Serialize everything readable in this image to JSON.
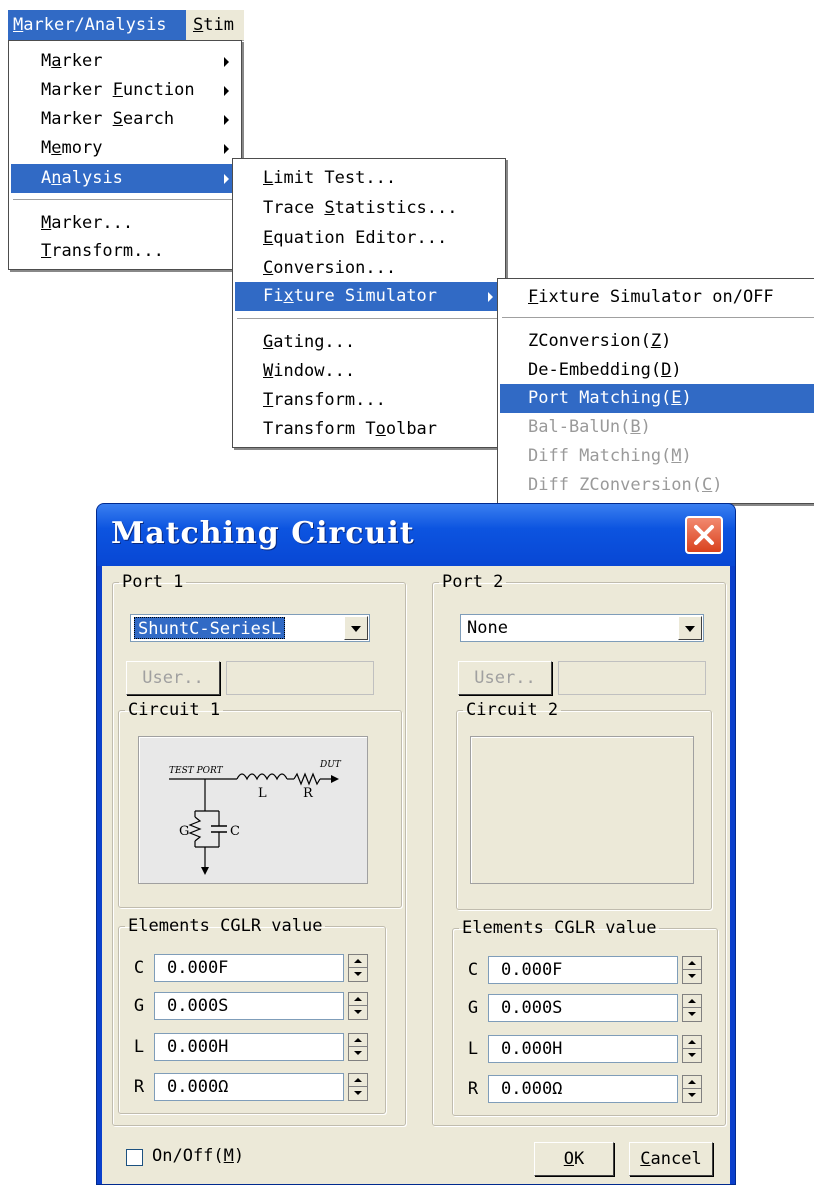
{
  "menubar": {
    "items": [
      {
        "label": "Marker/Analysis",
        "mnemonic_index": 0,
        "active": true
      },
      {
        "label": "Stim",
        "mnemonic_index": 0,
        "active": false
      }
    ]
  },
  "main_menu": {
    "items": [
      {
        "label": "Marker",
        "mnemonic_index": 1,
        "submenu": true
      },
      {
        "label": "Marker Function",
        "mnemonic_index": 7,
        "submenu": true
      },
      {
        "label": "Marker Search",
        "mnemonic_index": 7,
        "submenu": true
      },
      {
        "label": "Memory",
        "mnemonic_index": 1,
        "submenu": true
      },
      {
        "label": "Analysis",
        "mnemonic_index": 1,
        "submenu": true,
        "highlighted": true
      },
      {
        "label": "Marker...",
        "mnemonic_index": 0,
        "submenu": false
      },
      {
        "label": "Transform...",
        "mnemonic_index": 0,
        "submenu": false
      }
    ]
  },
  "analysis_menu": {
    "items": [
      {
        "label": "Limit Test...",
        "mnemonic_index": 0
      },
      {
        "label": "Trace Statistics...",
        "mnemonic_index": 6
      },
      {
        "label": "Equation Editor...",
        "mnemonic_index": 0
      },
      {
        "label": "Conversion...",
        "mnemonic_index": 0
      },
      {
        "label": "Fixture Simulator",
        "mnemonic_index": 2,
        "submenu": true,
        "highlighted": true
      },
      {
        "label": "Gating...",
        "mnemonic_index": 0
      },
      {
        "label": "Window...",
        "mnemonic_index": 0
      },
      {
        "label": "Transform...",
        "mnemonic_index": 0
      },
      {
        "label": "Transform Toolbar",
        "mnemonic_index": 11
      }
    ]
  },
  "fixture_menu": {
    "items": [
      {
        "label": "Fixture Simulator on/OFF",
        "mnemonic_index": 0,
        "enabled": true
      },
      {
        "label": "ZConversion(Z)",
        "mnemonic_index": 12,
        "enabled": true
      },
      {
        "label": "De-Embedding(D)",
        "mnemonic_index": 13,
        "enabled": true
      },
      {
        "label": "Port Matching(E)",
        "mnemonic_index": 14,
        "enabled": true,
        "highlighted": true
      },
      {
        "label": "Bal-BalUn(B)",
        "mnemonic_index": 10,
        "enabled": false
      },
      {
        "label": "Diff Matching(M)",
        "mnemonic_index": 14,
        "enabled": false
      },
      {
        "label": "Diff ZConversion(C)",
        "mnemonic_index": 17,
        "enabled": false
      }
    ]
  },
  "dialog": {
    "title": "Matching Circuit",
    "port1": {
      "label": "Port 1",
      "combo_value": "ShuntC-SeriesL",
      "user_button": "User..",
      "circuit_label": "Circuit 1",
      "diagram": {
        "test_port": "TEST PORT",
        "dut": "DUT",
        "L": "L",
        "R": "R",
        "G": "G",
        "C": "C"
      },
      "elements_label": "Elements CGLR value",
      "elements": [
        {
          "name": "C",
          "value": "0.000F"
        },
        {
          "name": "G",
          "value": "0.000S"
        },
        {
          "name": "L",
          "value": "0.000H"
        },
        {
          "name": "R",
          "value": "0.000Ω"
        }
      ]
    },
    "port2": {
      "label": "Port 2",
      "combo_value": "None",
      "user_button": "User..",
      "circuit_label": "Circuit 2",
      "elements_label": "Elements CGLR value",
      "elements": [
        {
          "name": "C",
          "value": "0.000F"
        },
        {
          "name": "G",
          "value": "0.000S"
        },
        {
          "name": "L",
          "value": "0.000H"
        },
        {
          "name": "R",
          "value": "0.000Ω"
        }
      ]
    },
    "onoff_label": "On/Off(M)",
    "onoff_checked": false,
    "ok_label": "OK",
    "cancel_label": "Cancel"
  },
  "colors": {
    "highlight": "#316ac5",
    "title_bar": "#0c54e0",
    "dialog_face": "#ece9d8",
    "close_button": "#d9421e"
  }
}
